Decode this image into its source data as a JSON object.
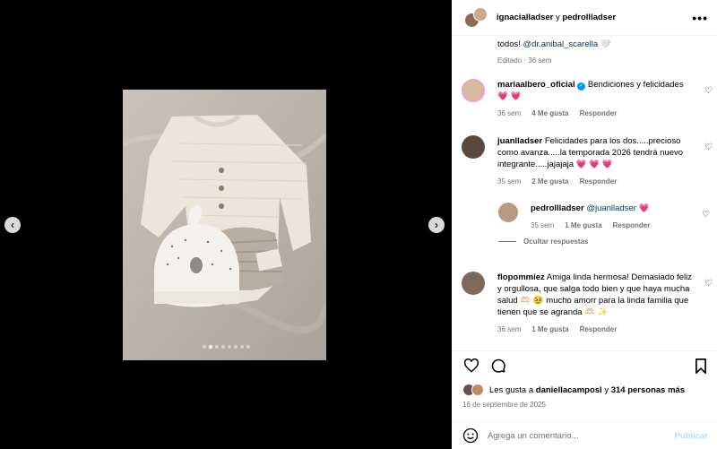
{
  "header": {
    "user1": "ignacialladser",
    "conjunction": "y",
    "user2": "pedrollladser",
    "more_label": "•••"
  },
  "caption_tail": {
    "text": "todos!",
    "mention": "@dr.anibal_scarella",
    "emoji": "🤍",
    "edited": "Editado",
    "time": "36 sem"
  },
  "comments": [
    {
      "user": "mariaalbero_oficial",
      "text": "Bendiciones y felicidades",
      "emoji": "💗 💗",
      "time": "36 sem",
      "likes": "4 Me gusta",
      "reply": "Responder"
    },
    {
      "user": "juanlladser",
      "text": "Felicidades para los dos.....precioso como avanza.....la temporada 2026 tendrá nuevo integrante.....jajajaja",
      "emoji": "💗 💗 💗",
      "time": "35 sem",
      "likes": "2 Me gusta",
      "reply": "Responder"
    },
    {
      "user": "flopommiez",
      "text": "Amiga linda hermosa! Demasiado feliz y orgullosa, que salga todo bien y que haya mucha salud 🫶🏻 🥹 mucho amorr para la linda familia que tienen que se agranda 🫶🏻 ✨",
      "time": "36 sem",
      "likes": "1 Me gusta",
      "reply": "Responder"
    }
  ],
  "reply": {
    "user": "pedrollladser",
    "mention": "@juanlladser",
    "emoji": "💗",
    "time": "35 sem",
    "likes": "1 Me gusta",
    "reply": "Responder"
  },
  "hide_replies": "Ocultar respuestas",
  "likes": {
    "prefix": "Les gusta a",
    "user": "daniellacamposl",
    "middle": "y",
    "count": "314 personas más"
  },
  "date": "16 de septiembre de 2025",
  "add_comment": {
    "placeholder": "Agrega un comentario...",
    "publish": "Publicar"
  },
  "carousel": {
    "current": 2,
    "total": 8
  },
  "icons": [
    "chevron-left-icon",
    "chevron-right-icon",
    "more-icon",
    "heart-icon",
    "comment-icon",
    "bookmark-icon",
    "emoji-icon",
    "verified-icon"
  ],
  "colors": {
    "link": "#00376b",
    "meta": "#737373",
    "verified": "#0095f6",
    "heart": "#ff3040",
    "publish_disabled": "#b2dffc"
  }
}
